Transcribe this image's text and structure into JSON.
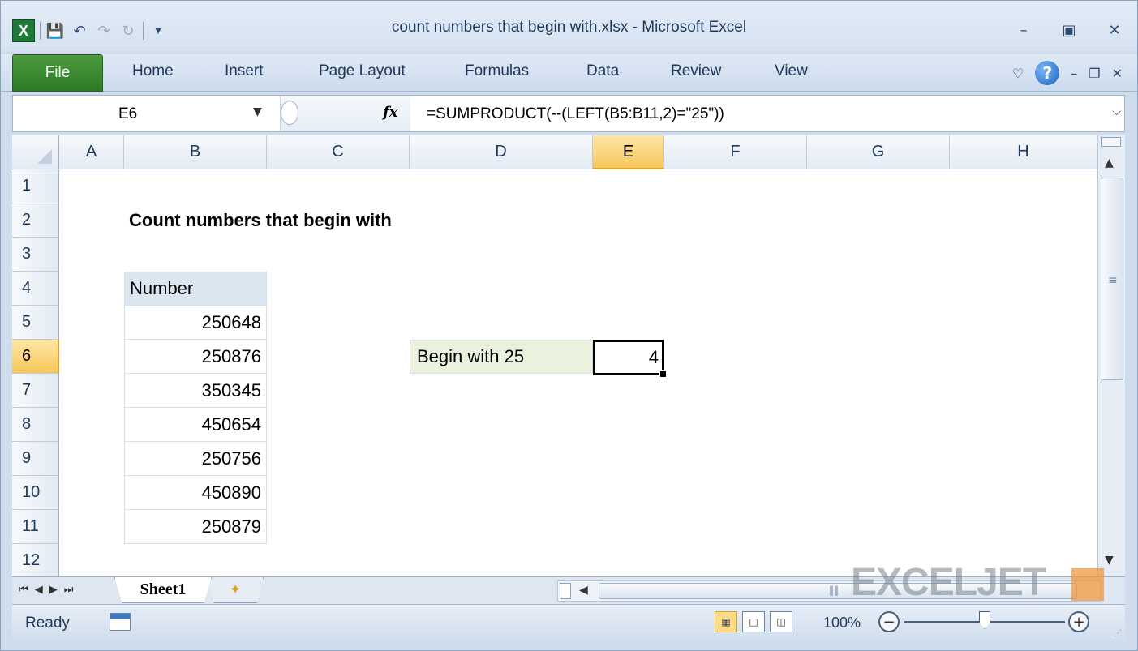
{
  "app": {
    "title": "count numbers that begin with.xlsx  -  Microsoft Excel",
    "logo": "X"
  },
  "ribbon": {
    "tabs": [
      "File",
      "Home",
      "Insert",
      "Page Layout",
      "Formulas",
      "Data",
      "Review",
      "View"
    ]
  },
  "formula_bar": {
    "name_box": "E6",
    "fx": "fx",
    "formula": "=SUMPRODUCT(--(LEFT(B5:B11,2)=\"25\"))"
  },
  "grid": {
    "columns": [
      "A",
      "B",
      "C",
      "D",
      "E",
      "F",
      "G",
      "H"
    ],
    "rows": [
      "1",
      "2",
      "3",
      "4",
      "5",
      "6",
      "7",
      "8",
      "9",
      "10",
      "11",
      "12"
    ],
    "active_column": "E",
    "active_row": "6"
  },
  "sheet": {
    "title": "Count numbers that begin with",
    "header": "Number",
    "numbers": [
      "250648",
      "250876",
      "350345",
      "450654",
      "250756",
      "450890",
      "250879"
    ],
    "label": "Begin with 25",
    "result": "4"
  },
  "sheet_tabs": {
    "active": "Sheet1"
  },
  "status": {
    "ready": "Ready",
    "zoom": "100%"
  },
  "watermark": "EXCELJET",
  "colors": {
    "file_tab": "#2c7a25",
    "header_fill": "#dce6f1",
    "label_fill": "#eaf1dd",
    "active_header": "#f7c75a"
  }
}
